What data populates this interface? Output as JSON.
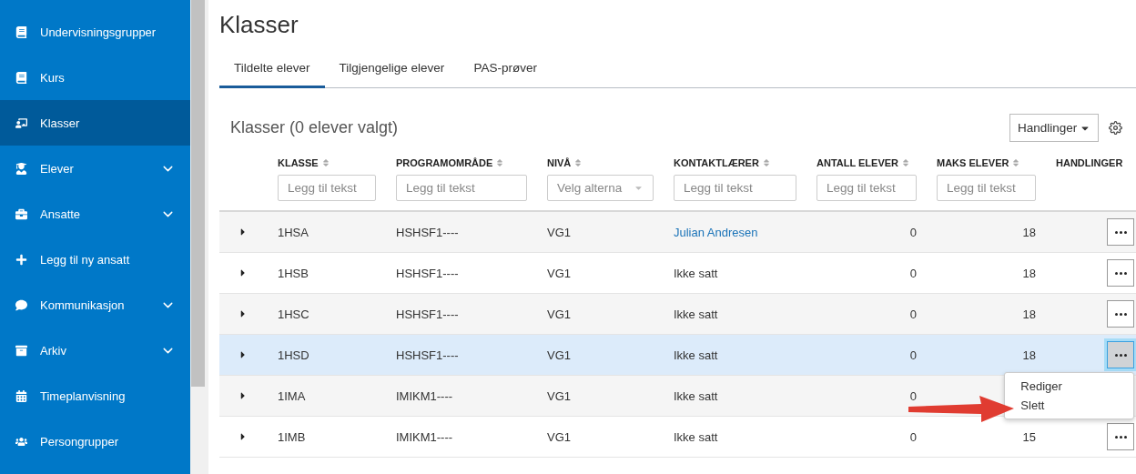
{
  "sidebar": {
    "items": [
      {
        "label": "Undervisningsgrupper",
        "kind": "link",
        "selected": false
      },
      {
        "label": "Kurs",
        "kind": "link",
        "selected": false
      },
      {
        "label": "Klasser",
        "kind": "link",
        "selected": true
      },
      {
        "label": "Elever",
        "kind": "group",
        "selected": false
      },
      {
        "label": "Ansatte",
        "kind": "group",
        "selected": false
      },
      {
        "label": "Legg til ny ansatt",
        "kind": "link",
        "selected": false
      },
      {
        "label": "Kommunikasjon",
        "kind": "group",
        "selected": false
      },
      {
        "label": "Arkiv",
        "kind": "group",
        "selected": false
      },
      {
        "label": "Timeplanvisning",
        "kind": "link",
        "selected": false
      },
      {
        "label": "Persongrupper",
        "kind": "link",
        "selected": false
      }
    ]
  },
  "page_title": "Klasser",
  "tabs": [
    {
      "label": "Tildelte elever",
      "selected": true
    },
    {
      "label": "Tilgjengelige elever",
      "selected": false
    },
    {
      "label": "PAS-prøver",
      "selected": false
    }
  ],
  "panel": {
    "title": "Klasser (0 elever valgt)",
    "actions_button": "Handlinger"
  },
  "table": {
    "columns": [
      {
        "label": "KLASSE",
        "sortable": true,
        "filter": {
          "kind": "text",
          "placeholder": "Legg til tekst"
        }
      },
      {
        "label": "PROGRAMOMRÅDE",
        "sortable": true,
        "filter": {
          "kind": "text",
          "placeholder": "Legg til tekst"
        }
      },
      {
        "label": "NIVÅ",
        "sortable": true,
        "filter": {
          "kind": "select",
          "placeholder": "Velg alterna"
        }
      },
      {
        "label": "KONTAKTLÆRER",
        "sortable": true,
        "filter": {
          "kind": "text",
          "placeholder": "Legg til tekst"
        }
      },
      {
        "label": "ANTALL ELEVER",
        "sortable": true,
        "filter": {
          "kind": "text",
          "placeholder": "Legg til tekst"
        }
      },
      {
        "label": "MAKS ELEVER",
        "sortable": true,
        "filter": {
          "kind": "text",
          "placeholder": "Legg til tekst"
        }
      },
      {
        "label": "HANDLINGER",
        "sortable": false
      }
    ],
    "rows": [
      {
        "klasse": "1HSA",
        "program": "HSHSF1----",
        "niva": "VG1",
        "contact": "Julian Andresen",
        "contact_link": true,
        "antall": "0",
        "maks": "18",
        "expanded": false,
        "selected": false
      },
      {
        "klasse": "1HSB",
        "program": "HSHSF1----",
        "niva": "VG1",
        "contact": "Ikke satt",
        "contact_link": false,
        "antall": "0",
        "maks": "18",
        "expanded": false,
        "selected": false
      },
      {
        "klasse": "1HSC",
        "program": "HSHSF1----",
        "niva": "VG1",
        "contact": "Ikke satt",
        "contact_link": false,
        "antall": "0",
        "maks": "18",
        "expanded": false,
        "selected": false
      },
      {
        "klasse": "1HSD",
        "program": "HSHSF1----",
        "niva": "VG1",
        "contact": "Ikke satt",
        "contact_link": false,
        "antall": "0",
        "maks": "18",
        "expanded": false,
        "selected": true,
        "menu": [
          "Rediger",
          "Slett"
        ]
      },
      {
        "klasse": "1IMA",
        "program": "IMIKM1----",
        "niva": "VG1",
        "contact": "Ikke satt",
        "contact_link": false,
        "antall": "0",
        "maks": "",
        "expanded": false,
        "selected": false
      },
      {
        "klasse": "1IMB",
        "program": "IMIKM1----",
        "niva": "VG1",
        "contact": "Ikke satt",
        "contact_link": false,
        "antall": "0",
        "maks": "15",
        "expanded": false,
        "selected": false
      }
    ]
  }
}
